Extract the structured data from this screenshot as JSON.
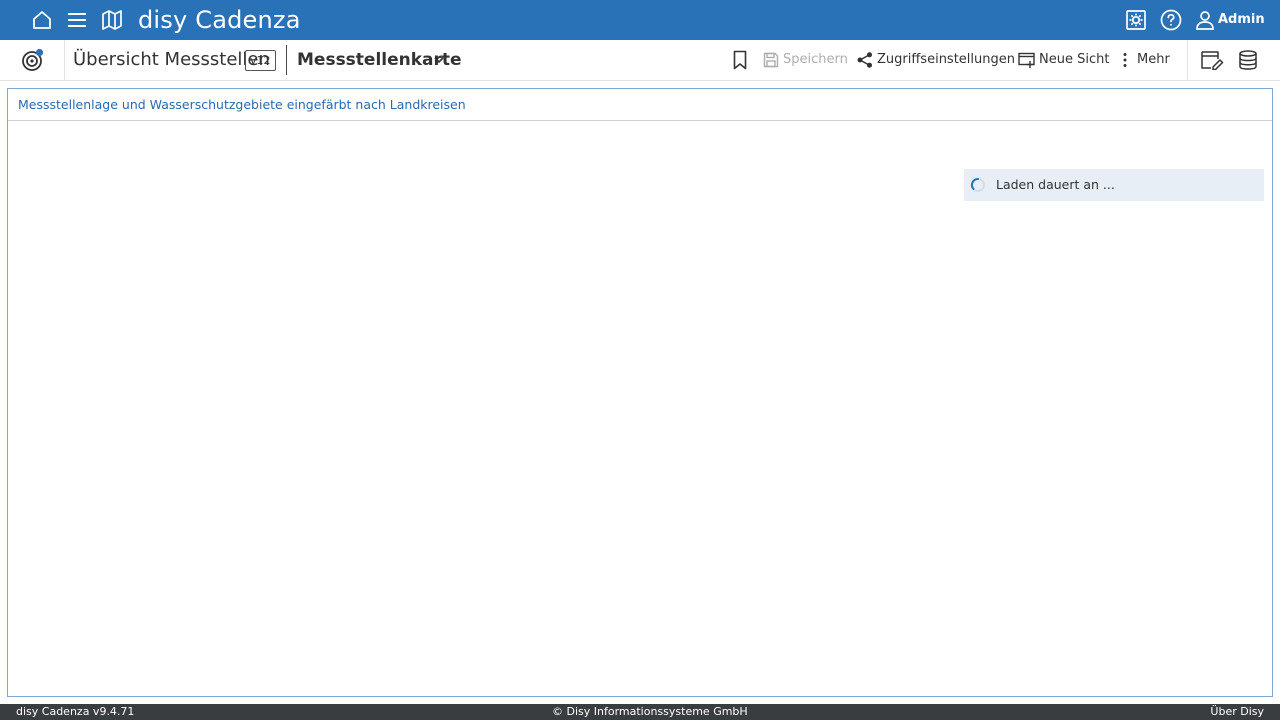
{
  "app": {
    "brand": "disy Cadenza",
    "user": "Admin",
    "nav_icons": [
      "home-icon",
      "menu-icon",
      "map-icon"
    ],
    "right_icons": [
      "settings-icon",
      "help-icon",
      "user-icon"
    ],
    "accent_color": "#2a72b8"
  },
  "toolbar": {
    "workbook_title": "Übersicht Messstellen",
    "version": "v12",
    "view_title": "Messstellenkarte",
    "bookmark_icon": "bookmark-icon",
    "save_label": "Speichern",
    "access_label": "Zugriffseinstellungen",
    "new_view_label": "Neue Sicht",
    "more_label": "Mehr",
    "edit_icon": "edit-icon",
    "database_icon": "database-icon"
  },
  "panel": {
    "title": "Messstellenlage und Wasserschutzgebiete eingefärbt nach Landkreisen",
    "loading_text": "Laden dauert an ..."
  },
  "footer": {
    "version": "disy Cadenza v9.4.71",
    "copyright": "© Disy Informationssysteme GmbH",
    "about": "Über Disy"
  }
}
